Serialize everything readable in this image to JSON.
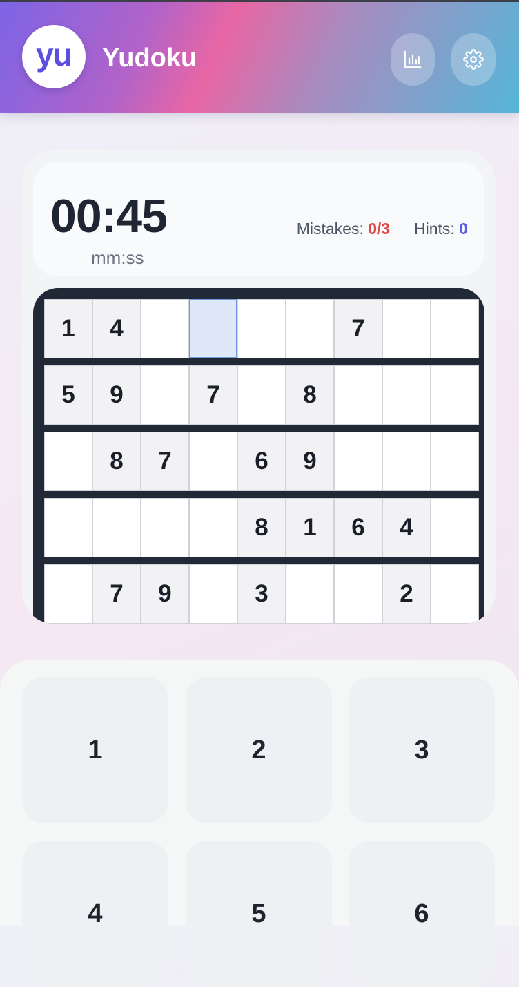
{
  "header": {
    "logo_text": "yu",
    "title": "Yudoku",
    "stats_icon": "bar-chart-icon",
    "settings_icon": "gear-icon"
  },
  "status": {
    "time": "00:45",
    "time_unit": "mm:ss",
    "mistakes_label": "Mistakes:",
    "mistakes_value": "0/3",
    "hints_label": "Hints:",
    "hints_value": "0"
  },
  "board": {
    "rows": [
      [
        "1",
        "4",
        "",
        "",
        "",
        "",
        "7",
        "",
        ""
      ],
      [
        "5",
        "9",
        "",
        "7",
        "",
        "8",
        "",
        "",
        ""
      ],
      [
        "",
        "8",
        "7",
        "",
        "6",
        "9",
        "",
        "",
        ""
      ],
      [
        "",
        "",
        "",
        "",
        "8",
        "1",
        "6",
        "4",
        ""
      ],
      [
        "",
        "7",
        "9",
        "",
        "3",
        "",
        "",
        "2",
        ""
      ]
    ],
    "given": [
      [
        1,
        1,
        0,
        0,
        0,
        0,
        1,
        0,
        0
      ],
      [
        1,
        1,
        0,
        1,
        0,
        1,
        0,
        0,
        0
      ],
      [
        0,
        1,
        1,
        0,
        1,
        1,
        0,
        0,
        0
      ],
      [
        0,
        0,
        0,
        0,
        1,
        1,
        1,
        1,
        0
      ],
      [
        0,
        1,
        1,
        0,
        1,
        0,
        0,
        1,
        0
      ]
    ],
    "selected_cell": {
      "row": 0,
      "col": 3
    }
  },
  "numpad": {
    "keys": [
      "1",
      "2",
      "3",
      "4",
      "5",
      "6"
    ]
  },
  "colors": {
    "accent": "#5b4fe0",
    "mistakes": "#e04848",
    "hints": "#5b5ce0",
    "board_frame": "#222936"
  }
}
